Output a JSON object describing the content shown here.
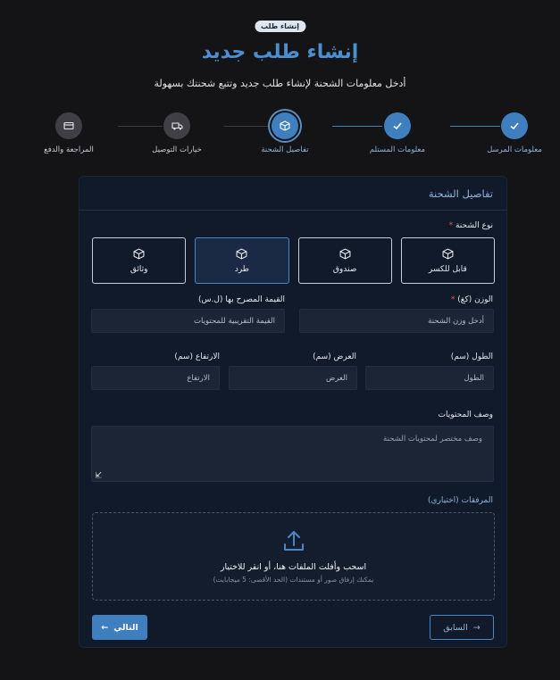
{
  "badge": "إنشاء طلب",
  "title": "إنشاء طلب جديد",
  "subtitle": "أدخل معلومات الشحنة لإنشاء طلب جديد وتتبع شحنتك بسهولة",
  "steps": [
    {
      "label": "معلومات المرسل",
      "state": "done",
      "icon": "check-icon"
    },
    {
      "label": "معلومات المستلم",
      "state": "done",
      "icon": "check-icon"
    },
    {
      "label": "تفاصيل الشحنة",
      "state": "active",
      "icon": "package-icon"
    },
    {
      "label": "خيارات التوصيل",
      "state": "pending",
      "icon": "truck-icon"
    },
    {
      "label": "المراجعة والدفع",
      "state": "pending",
      "icon": "credit-card-icon"
    }
  ],
  "card": {
    "header": "تفاصيل الشحنة",
    "shipment_type_label": "نوع الشحنة",
    "required_mark": "*",
    "types": [
      {
        "label": "وثائق",
        "selected": false
      },
      {
        "label": "طرد",
        "selected": true
      },
      {
        "label": "صندوق",
        "selected": false
      },
      {
        "label": "قابل للكسر",
        "selected": false
      }
    ],
    "weight_label": "الوزن (كغ)",
    "weight_placeholder": "أدخل وزن الشحنة",
    "value_label": "القيمة المصرح بها (ل.س)",
    "value_placeholder": "القيمة التقريبية للمحتويات",
    "length_label": "الطول (سم)",
    "length_placeholder": "الطول",
    "width_label": "العرض (سم)",
    "width_placeholder": "العرض",
    "height_label": "الارتفاع (سم)",
    "height_placeholder": "الارتفاع",
    "description_label": "وصف المحتويات",
    "description_placeholder": "وصف مختصر لمحتويات الشحنة",
    "attachments_label": "المرفقات (اختياري)",
    "dropzone_main": "اسحب وأفلت الملفات هنا، أو انقر للاختيار",
    "dropzone_sub": "يمكنك إرفاق صور أو مستندات (الحد الأقصى: 5 ميجابايت)",
    "next_label": "التالي",
    "prev_label": "السابق"
  },
  "colors": {
    "accent": "#3f7fbf",
    "background": "#141416",
    "card": "#111a2b",
    "required": "#e05656"
  }
}
